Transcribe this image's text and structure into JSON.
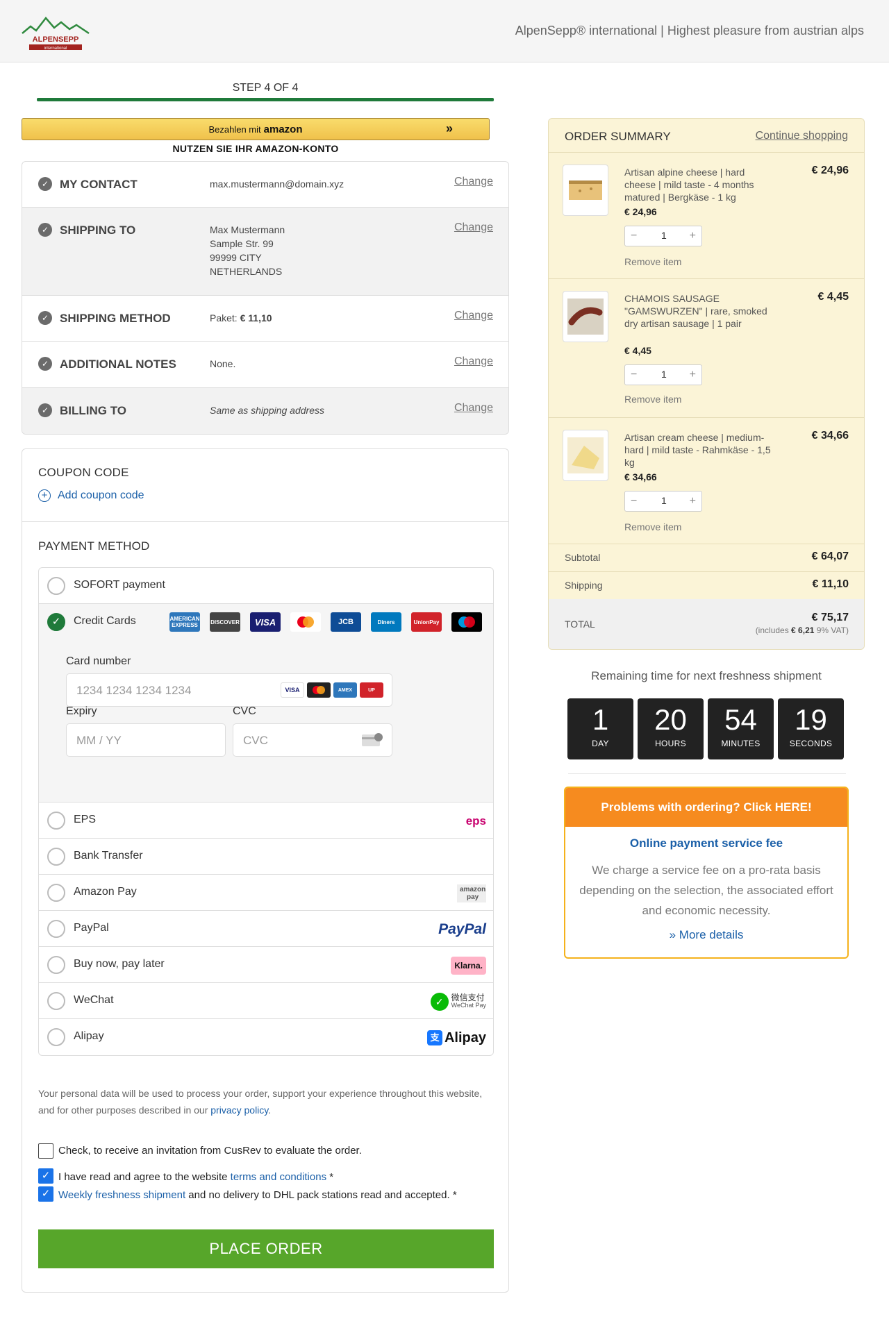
{
  "header": {
    "logo_text": "ALPENSEPP",
    "logo_sub": "international",
    "tagline": "AlpenSepp® international | Highest pleasure from austrian alps"
  },
  "step": {
    "label": "STEP 4 OF 4",
    "progress": 1.0
  },
  "amazon": {
    "button_prefix": "Bezahlen mit",
    "button_brand": "amazon",
    "subtitle": "NUTZEN SIE IHR AMAZON-KONTO"
  },
  "review": {
    "change_label": "Change",
    "contact": {
      "title": "MY CONTACT",
      "value": "max.mustermann@domain.xyz"
    },
    "shipping_to": {
      "title": "SHIPPING TO",
      "lines": [
        "Max Mustermann",
        "Sample Str. 99",
        "99999 CITY",
        "NETHERLANDS"
      ]
    },
    "shipping_method": {
      "title": "SHIPPING METHOD",
      "prefix": "Paket:",
      "amount": "€ 11,10"
    },
    "notes": {
      "title": "ADDITIONAL NOTES",
      "value": "None."
    },
    "billing": {
      "title": "BILLING TO",
      "value": "Same as shipping address"
    }
  },
  "coupon": {
    "title": "COUPON CODE",
    "link": "Add coupon code"
  },
  "payment": {
    "title": "PAYMENT METHOD",
    "methods": {
      "sofort": "SOFORT payment",
      "cards": "Credit Cards",
      "eps": "EPS",
      "bank": "Bank Transfer",
      "amazon": "Amazon Pay",
      "paypal": "PayPal",
      "bnpl": "Buy now, pay later",
      "wechat": "WeChat",
      "alipay": "Alipay"
    },
    "card_logos": [
      "AMERICAN EXPRESS",
      "DISCOVER",
      "VISA",
      "mastercard",
      "JCB",
      "Diners",
      "UnionPay",
      "maestro"
    ],
    "card_number_label": "Card number",
    "card_number_placeholder": "1234 1234 1234 1234",
    "expiry_label": "Expiry",
    "expiry_placeholder": "MM / YY",
    "cvc_label": "CVC",
    "cvc_placeholder": "CVC",
    "logos": {
      "eps": "eps",
      "amazon": "amazon pay",
      "paypal": "PayPal",
      "klarna": "Klarna.",
      "wechat": "微信支付",
      "wechat_sub": "WeChat Pay",
      "alipay": "Alipay"
    }
  },
  "legal": {
    "text": "Your personal data will be used to process your order, support your experience throughout this website, and for other purposes described in our ",
    "link": "privacy policy",
    "end": "."
  },
  "checks": {
    "cusrev": "Check, to receive an invitation from CusRev to evaluate the order.",
    "terms_prefix": "I have read and agree to the website ",
    "terms_link": "terms and conditions",
    "terms_suffix": " *",
    "weekly_link": "Weekly freshness shipment",
    "weekly_suffix": " and no delivery to DHL pack stations read and accepted. *"
  },
  "place_order": "PLACE ORDER",
  "order_summary": {
    "title": "ORDER SUMMARY",
    "continue": "Continue shopping",
    "remove_label": "Remove item",
    "items": [
      {
        "name": "Artisan alpine cheese | hard cheese | mild taste - 4 months matured | Bergkäse - 1 kg",
        "unit": "€ 24,96",
        "price": "€ 24,96",
        "qty": "1"
      },
      {
        "name": "CHAMOIS SAUSAGE \"GAMSWURZEN\" | rare, smoked dry artisan sausage | 1 pair",
        "unit": "€ 4,45",
        "price": "€ 4,45",
        "qty": "1"
      },
      {
        "name": "Artisan cream cheese | medium-hard | mild taste - Rahmkäse - 1,5 kg",
        "unit": "€ 34,66",
        "price": "€ 34,66",
        "qty": "1"
      }
    ],
    "subtotal_label": "Subtotal",
    "subtotal": "€ 64,07",
    "shipping_label": "Shipping",
    "shipping": "€ 11,10",
    "total_label": "TOTAL",
    "total": "€ 75,17",
    "vat_prefix": "(includes ",
    "vat_amount": "€ 6,21",
    "vat_suffix": " 9% VAT)"
  },
  "countdown": {
    "title": "Remaining time for next freshness shipment",
    "day": "1",
    "day_label": "DAY",
    "hours": "20",
    "hours_label": "HOURS",
    "minutes": "54",
    "minutes_label": "MINUTES",
    "seconds": "19",
    "seconds_label": "SECONDS"
  },
  "help": {
    "header": "Problems with ordering? Click HERE!",
    "subtitle": "Online payment service fee",
    "text": "We charge a service fee on a pro-rata basis depending on the selection, the associated effort and economic necessity.",
    "more": "» More details"
  },
  "colors": {
    "green": "#1f7a3a",
    "place_order": "#57a62a",
    "summary_bg": "#fbf4d7",
    "help_orange": "#f68b1f",
    "link_blue": "#1a5fa8"
  }
}
